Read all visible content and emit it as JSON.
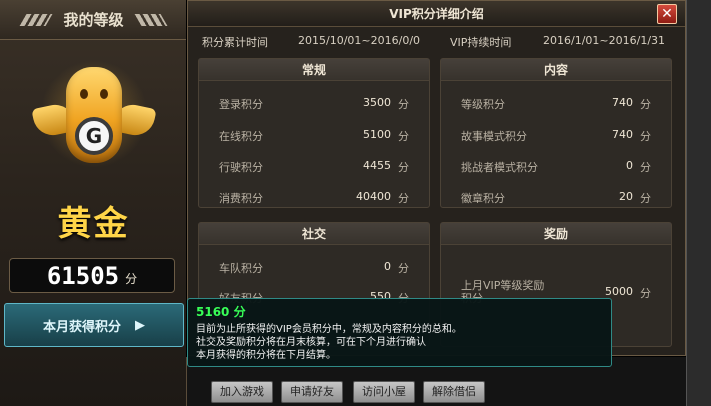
{
  "rank_panel": {
    "title": "我的等级",
    "rank_name": "黄金",
    "score": "61505",
    "score_unit": "分",
    "monthly_button_label": "本月获得积分",
    "monthly_button_arrow": "▶"
  },
  "dialog": {
    "title": "VIP积分详细介绍",
    "close_label": "✕",
    "accum_label": "积分累计时间",
    "accum_range": "2015/10/01~2016/0/0",
    "duration_label": "VIP持续时间",
    "duration_range": "2016/1/01~2016/1/31",
    "sections": {
      "regular": {
        "title": "常规",
        "rows": [
          {
            "label": "登录积分",
            "value": "3500",
            "unit": "分"
          },
          {
            "label": "在线积分",
            "value": "5100",
            "unit": "分"
          },
          {
            "label": "行驶积分",
            "value": "4455",
            "unit": "分"
          },
          {
            "label": "消费积分",
            "value": "40400",
            "unit": "分"
          }
        ]
      },
      "content": {
        "title": "内容",
        "rows": [
          {
            "label": "等级积分",
            "value": "740",
            "unit": "分"
          },
          {
            "label": "故事模式积分",
            "value": "740",
            "unit": "分"
          },
          {
            "label": "挑战者模式积分",
            "value": "0",
            "unit": "分"
          },
          {
            "label": "徽章积分",
            "value": "20",
            "unit": "分"
          }
        ]
      },
      "social": {
        "title": "社交",
        "rows": [
          {
            "label": "车队积分",
            "value": "0",
            "unit": "分"
          },
          {
            "label": "好友积分",
            "value": "550",
            "unit": "分"
          }
        ]
      },
      "reward": {
        "title": "奖励",
        "rows": [
          {
            "label": "上月VIP等级奖励积分",
            "value": "5000",
            "unit": "分"
          }
        ]
      }
    }
  },
  "tooltip": {
    "score": "5160 分",
    "line1": "目前为止所获得的VIP会员积分中，常规及内容积分的总和。",
    "line2": "社交及奖励积分将在月末核算，可在下个月进行确认",
    "line3": "本月获得的积分将在下月结算。"
  },
  "actions": {
    "join_game": "加入游戏",
    "add_friend": "申请好友",
    "visit_house": "访问小屋",
    "remove_block": "解除借侣"
  },
  "colors": {
    "gold": "#ffd548",
    "tooltip_green": "#38ff57",
    "button_teal": "#2b6a78"
  }
}
